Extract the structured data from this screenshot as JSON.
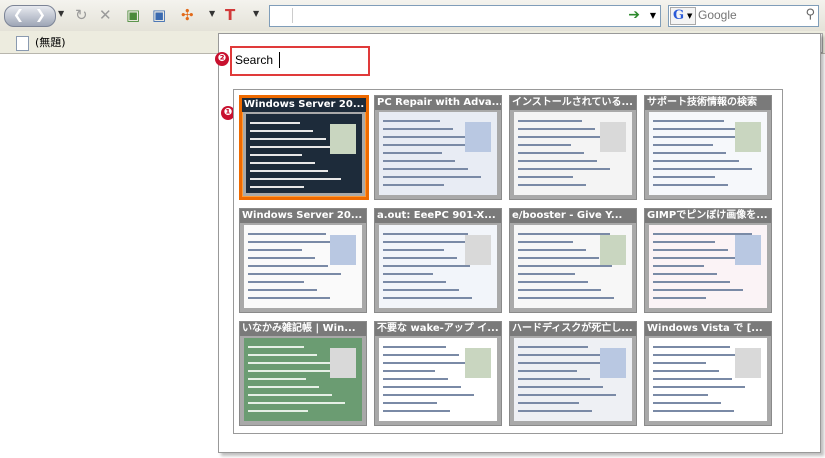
{
  "toolbar": {
    "buttons": [
      {
        "name": "back-button",
        "icon": "back-arrow-icon"
      },
      {
        "name": "forward-button",
        "icon": "forward-arrow-icon"
      },
      {
        "name": "reload-button",
        "icon": "reload-icon"
      },
      {
        "name": "stop-button",
        "icon": "stop-icon"
      },
      {
        "name": "new-tab-button",
        "icon": "new-tab-icon"
      },
      {
        "name": "new-window-button",
        "icon": "new-window-icon"
      },
      {
        "name": "gesture-button",
        "icon": "move-icon"
      },
      {
        "name": "text-tool-button",
        "icon": "text-icon"
      }
    ],
    "url_value": "",
    "search_engine": "G",
    "search_placeholder": "Google"
  },
  "tabbar": {
    "tab_label": "(無題)"
  },
  "popup": {
    "callout_search": "❷",
    "callout_selected": "❶",
    "filter_value": "Search",
    "thumbnails": [
      {
        "title": "Windows Server 20...",
        "selected": true,
        "page_color": "#1d2b3a"
      },
      {
        "title": "PC Repair with Adva...",
        "selected": false,
        "page_color": "#e8ecf4"
      },
      {
        "title": "インストールされている...",
        "selected": false,
        "page_color": "#f4f4f4"
      },
      {
        "title": "サポート技術情報の検索",
        "selected": false,
        "page_color": "#f6f8fb"
      },
      {
        "title": "Windows Server 20...",
        "selected": false,
        "page_color": "#fafafa"
      },
      {
        "title": "a.out: EeePC 901-X...",
        "selected": false,
        "page_color": "#f2f5fa"
      },
      {
        "title": "e/booster - Give Y...",
        "selected": false,
        "page_color": "#f7f7f7"
      },
      {
        "title": "GIMPでピンぼけ画像を...",
        "selected": false,
        "page_color": "#fbf3f6"
      },
      {
        "title": "いなかみ雑記帳 | Win...",
        "selected": false,
        "page_color": "#6b9c72"
      },
      {
        "title": "不要な wake-アップ イ...",
        "selected": false,
        "page_color": "#ffffff"
      },
      {
        "title": "ハードディスクが死亡し...",
        "selected": false,
        "page_color": "#eef0f4"
      },
      {
        "title": "Windows Vista で [...",
        "selected": false,
        "page_color": "#ffffff"
      }
    ]
  }
}
